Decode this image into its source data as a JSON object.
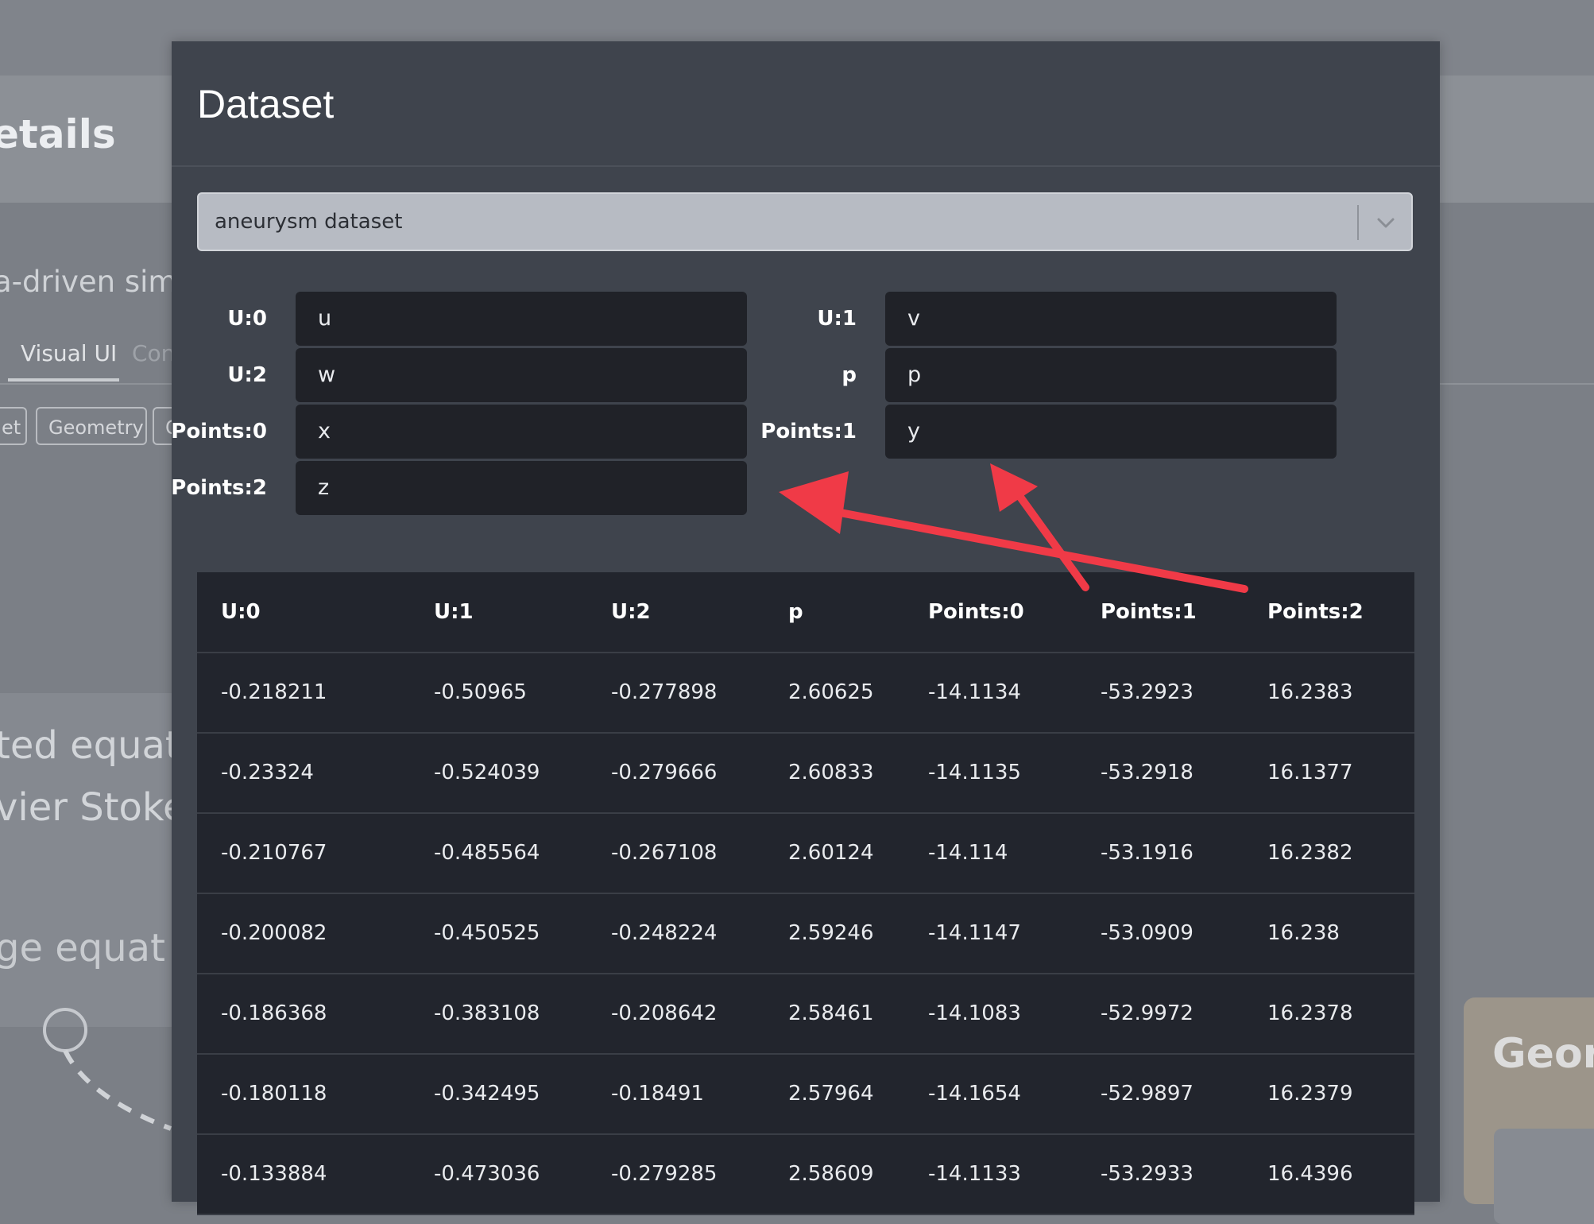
{
  "background": {
    "page_title_fragment": "etails",
    "subtitle_fragment": "a-driven simu",
    "tabs": [
      "Visual UI",
      "Con"
    ],
    "chips": [
      "et",
      "Geometry",
      "C"
    ],
    "equation_fragments": [
      "ted equatio",
      "vier Stokes",
      "ge equat"
    ],
    "node_label": "Geor"
  },
  "modal": {
    "title": "Dataset",
    "select": {
      "value": "aneurysm dataset",
      "icon": "chevron-down-icon"
    },
    "mappings": [
      {
        "label": "U:0",
        "value": "u"
      },
      {
        "label": "U:1",
        "value": "v"
      },
      {
        "label": "U:2",
        "value": "w"
      },
      {
        "label": "p",
        "value": "p"
      },
      {
        "label": "Points:0",
        "value": "x"
      },
      {
        "label": "Points:1",
        "value": "y"
      },
      {
        "label": "Points:2",
        "value": "z"
      }
    ],
    "table": {
      "headers": [
        "U:0",
        "U:1",
        "U:2",
        "p",
        "Points:0",
        "Points:1",
        "Points:2"
      ],
      "rows": [
        [
          "-0.218211",
          "-0.50965",
          "-0.277898",
          "2.60625",
          "-14.1134",
          "-53.2923",
          "16.2383"
        ],
        [
          "-0.23324",
          "-0.524039",
          "-0.279666",
          "2.60833",
          "-14.1135",
          "-53.2918",
          "16.1377"
        ],
        [
          "-0.210767",
          "-0.485564",
          "-0.267108",
          "2.60124",
          "-14.114",
          "-53.1916",
          "16.2382"
        ],
        [
          "-0.200082",
          "-0.450525",
          "-0.248224",
          "2.59246",
          "-14.1147",
          "-53.0909",
          "16.238"
        ],
        [
          "-0.186368",
          "-0.383108",
          "-0.208642",
          "2.58461",
          "-14.1083",
          "-52.9972",
          "16.2378"
        ],
        [
          "-0.180118",
          "-0.342495",
          "-0.18491",
          "2.57964",
          "-14.1654",
          "-52.9897",
          "16.2379"
        ],
        [
          "-0.133884",
          "-0.473036",
          "-0.279285",
          "2.58609",
          "-14.1133",
          "-53.2933",
          "16.4396"
        ]
      ]
    }
  },
  "annotation": {
    "arrow_color": "#f03a47"
  }
}
